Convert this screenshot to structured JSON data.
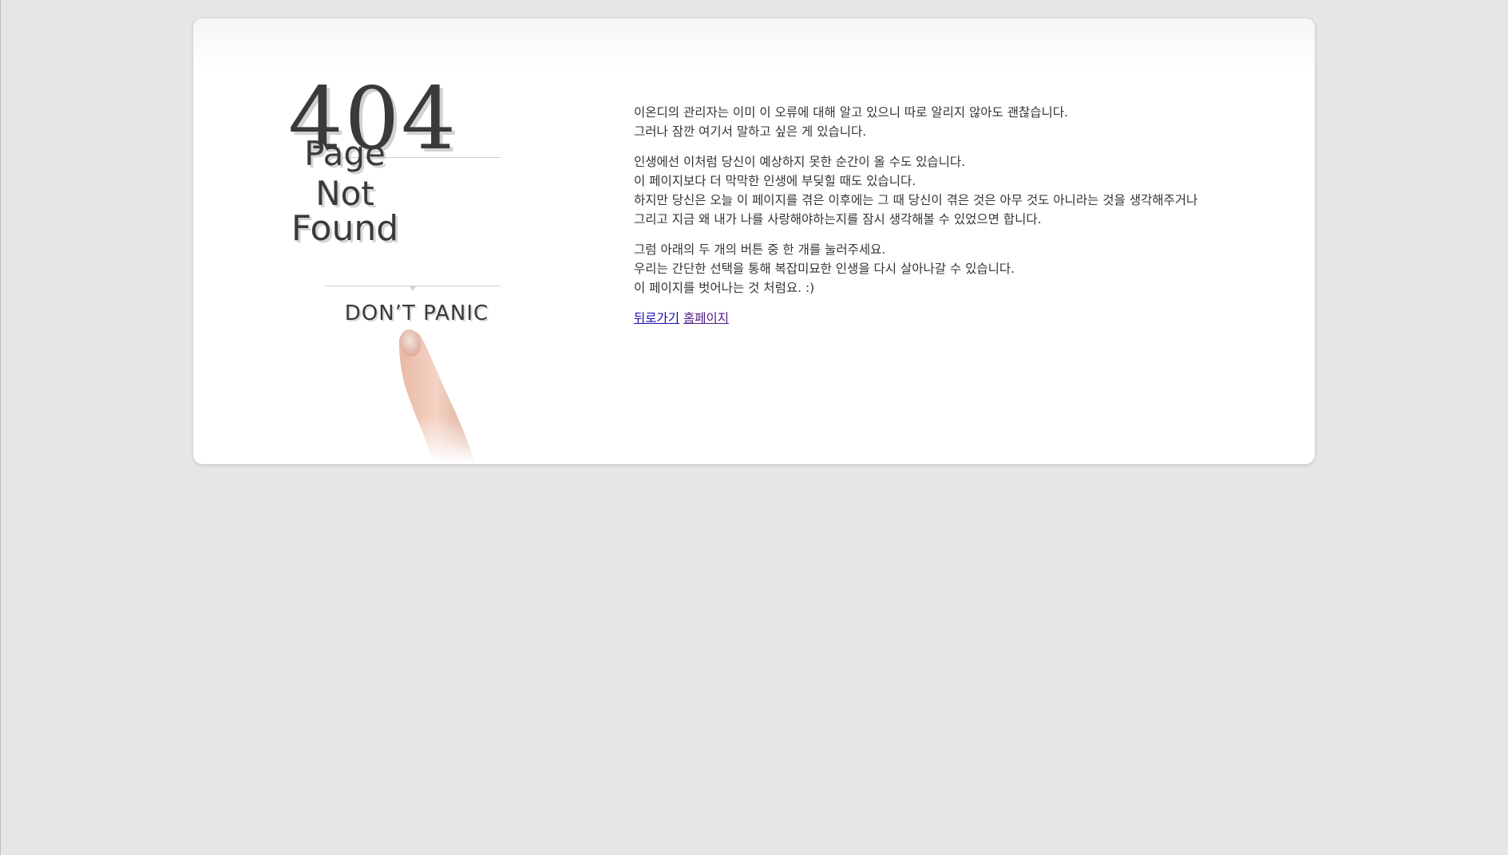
{
  "page": {
    "background_color": "#e6e6e6",
    "card_color": "#ffffff"
  },
  "illustration": {
    "code": "404",
    "line1": "Page",
    "line2": "Not",
    "line3": "Found",
    "tagline": "DON’T PANIC"
  },
  "message": {
    "paragraph1": [
      "이온디의 관리자는 이미 이 오류에 대해 알고 있으니 따로 알리지 않아도 괜찮습니다.",
      "그러나 잠깐 여기서 말하고 싶은 게 있습니다."
    ],
    "paragraph2": [
      "인생에선 이처럼 당신이 예상하지 못한 순간이 올 수도 있습니다.",
      "이 페이지보다 더 막막한 인생에 부딪힐 때도 있습니다.",
      "하지만 당신은 오늘 이 페이지를 겪은 이후에는 그 때 당신이 겪은 것은 아무 것도 아니라는 것을 생각해주거나",
      "그리고 지금 왜 내가 나를 사랑해야하는지를 잠시 생각해볼 수 있었으면 합니다."
    ],
    "paragraph3": [
      "그럼 아래의 두 개의 버튼 중 한 개를 눌러주세요.",
      "우리는 간단한 선택을 통해 복잡미묘한 인생을 다시 살아나갈 수 있습니다.",
      "이 페이지를 벗어나는 것 처럼요. :)"
    ]
  },
  "links": {
    "back_label": "뒤로가기",
    "home_label": "홈페이지",
    "link_color": "#1a0dab",
    "visited_color": "#551a8b"
  }
}
